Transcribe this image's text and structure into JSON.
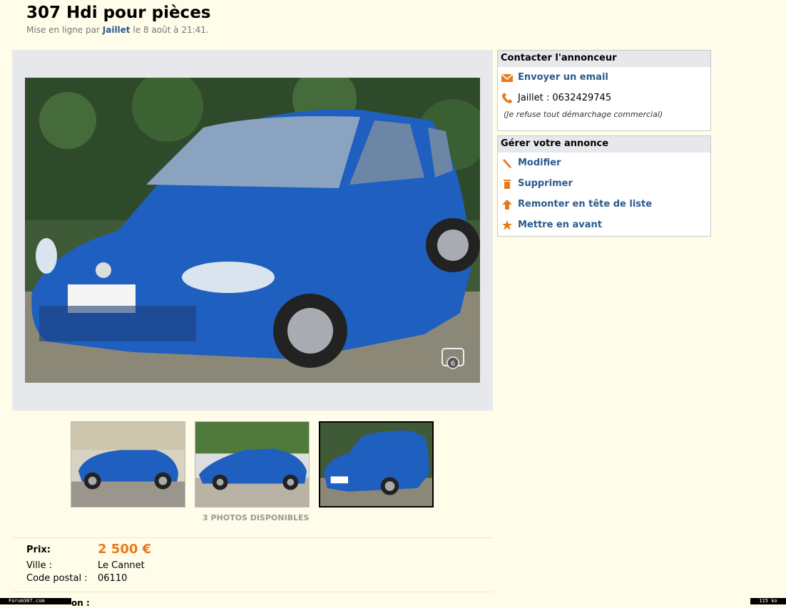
{
  "listing": {
    "title": "307 Hdi pour pièces",
    "posted_prefix": "Mise en ligne par",
    "author": "Jaillet",
    "posted_suffix": "le 8 août à 21:41."
  },
  "photos": {
    "count_label": "3 PHOTOS DISPONIBLES",
    "badge": "6",
    "car_color": "#1f5fbf"
  },
  "details": {
    "price_label": "Prix:",
    "price_value": "2 500 €",
    "city_label": "Ville :",
    "city_value": "Le Cannet",
    "postal_label": "Code postal :",
    "postal_value": "06110",
    "cut_heading": "on :"
  },
  "contact": {
    "header": "Contacter l'annonceur",
    "email_label": "Envoyer un email",
    "phone_label": "Jaillet : 0632429745",
    "note": "(Je refuse tout démarchage commercial)"
  },
  "manage": {
    "header": "Gérer votre annonce",
    "items": [
      {
        "label": "Modifier",
        "icon": "pencil-icon"
      },
      {
        "label": "Supprimer",
        "icon": "trash-icon"
      },
      {
        "label": "Remonter en tête de liste",
        "icon": "arrow-up-icon"
      },
      {
        "label": "Mettre en avant",
        "icon": "star-icon"
      }
    ]
  },
  "footer": {
    "left": "Forum307.com",
    "right": "115 ko"
  },
  "colors": {
    "accent": "#e97a1b",
    "link": "#2a5a8c",
    "page_bg": "#fffde9"
  }
}
